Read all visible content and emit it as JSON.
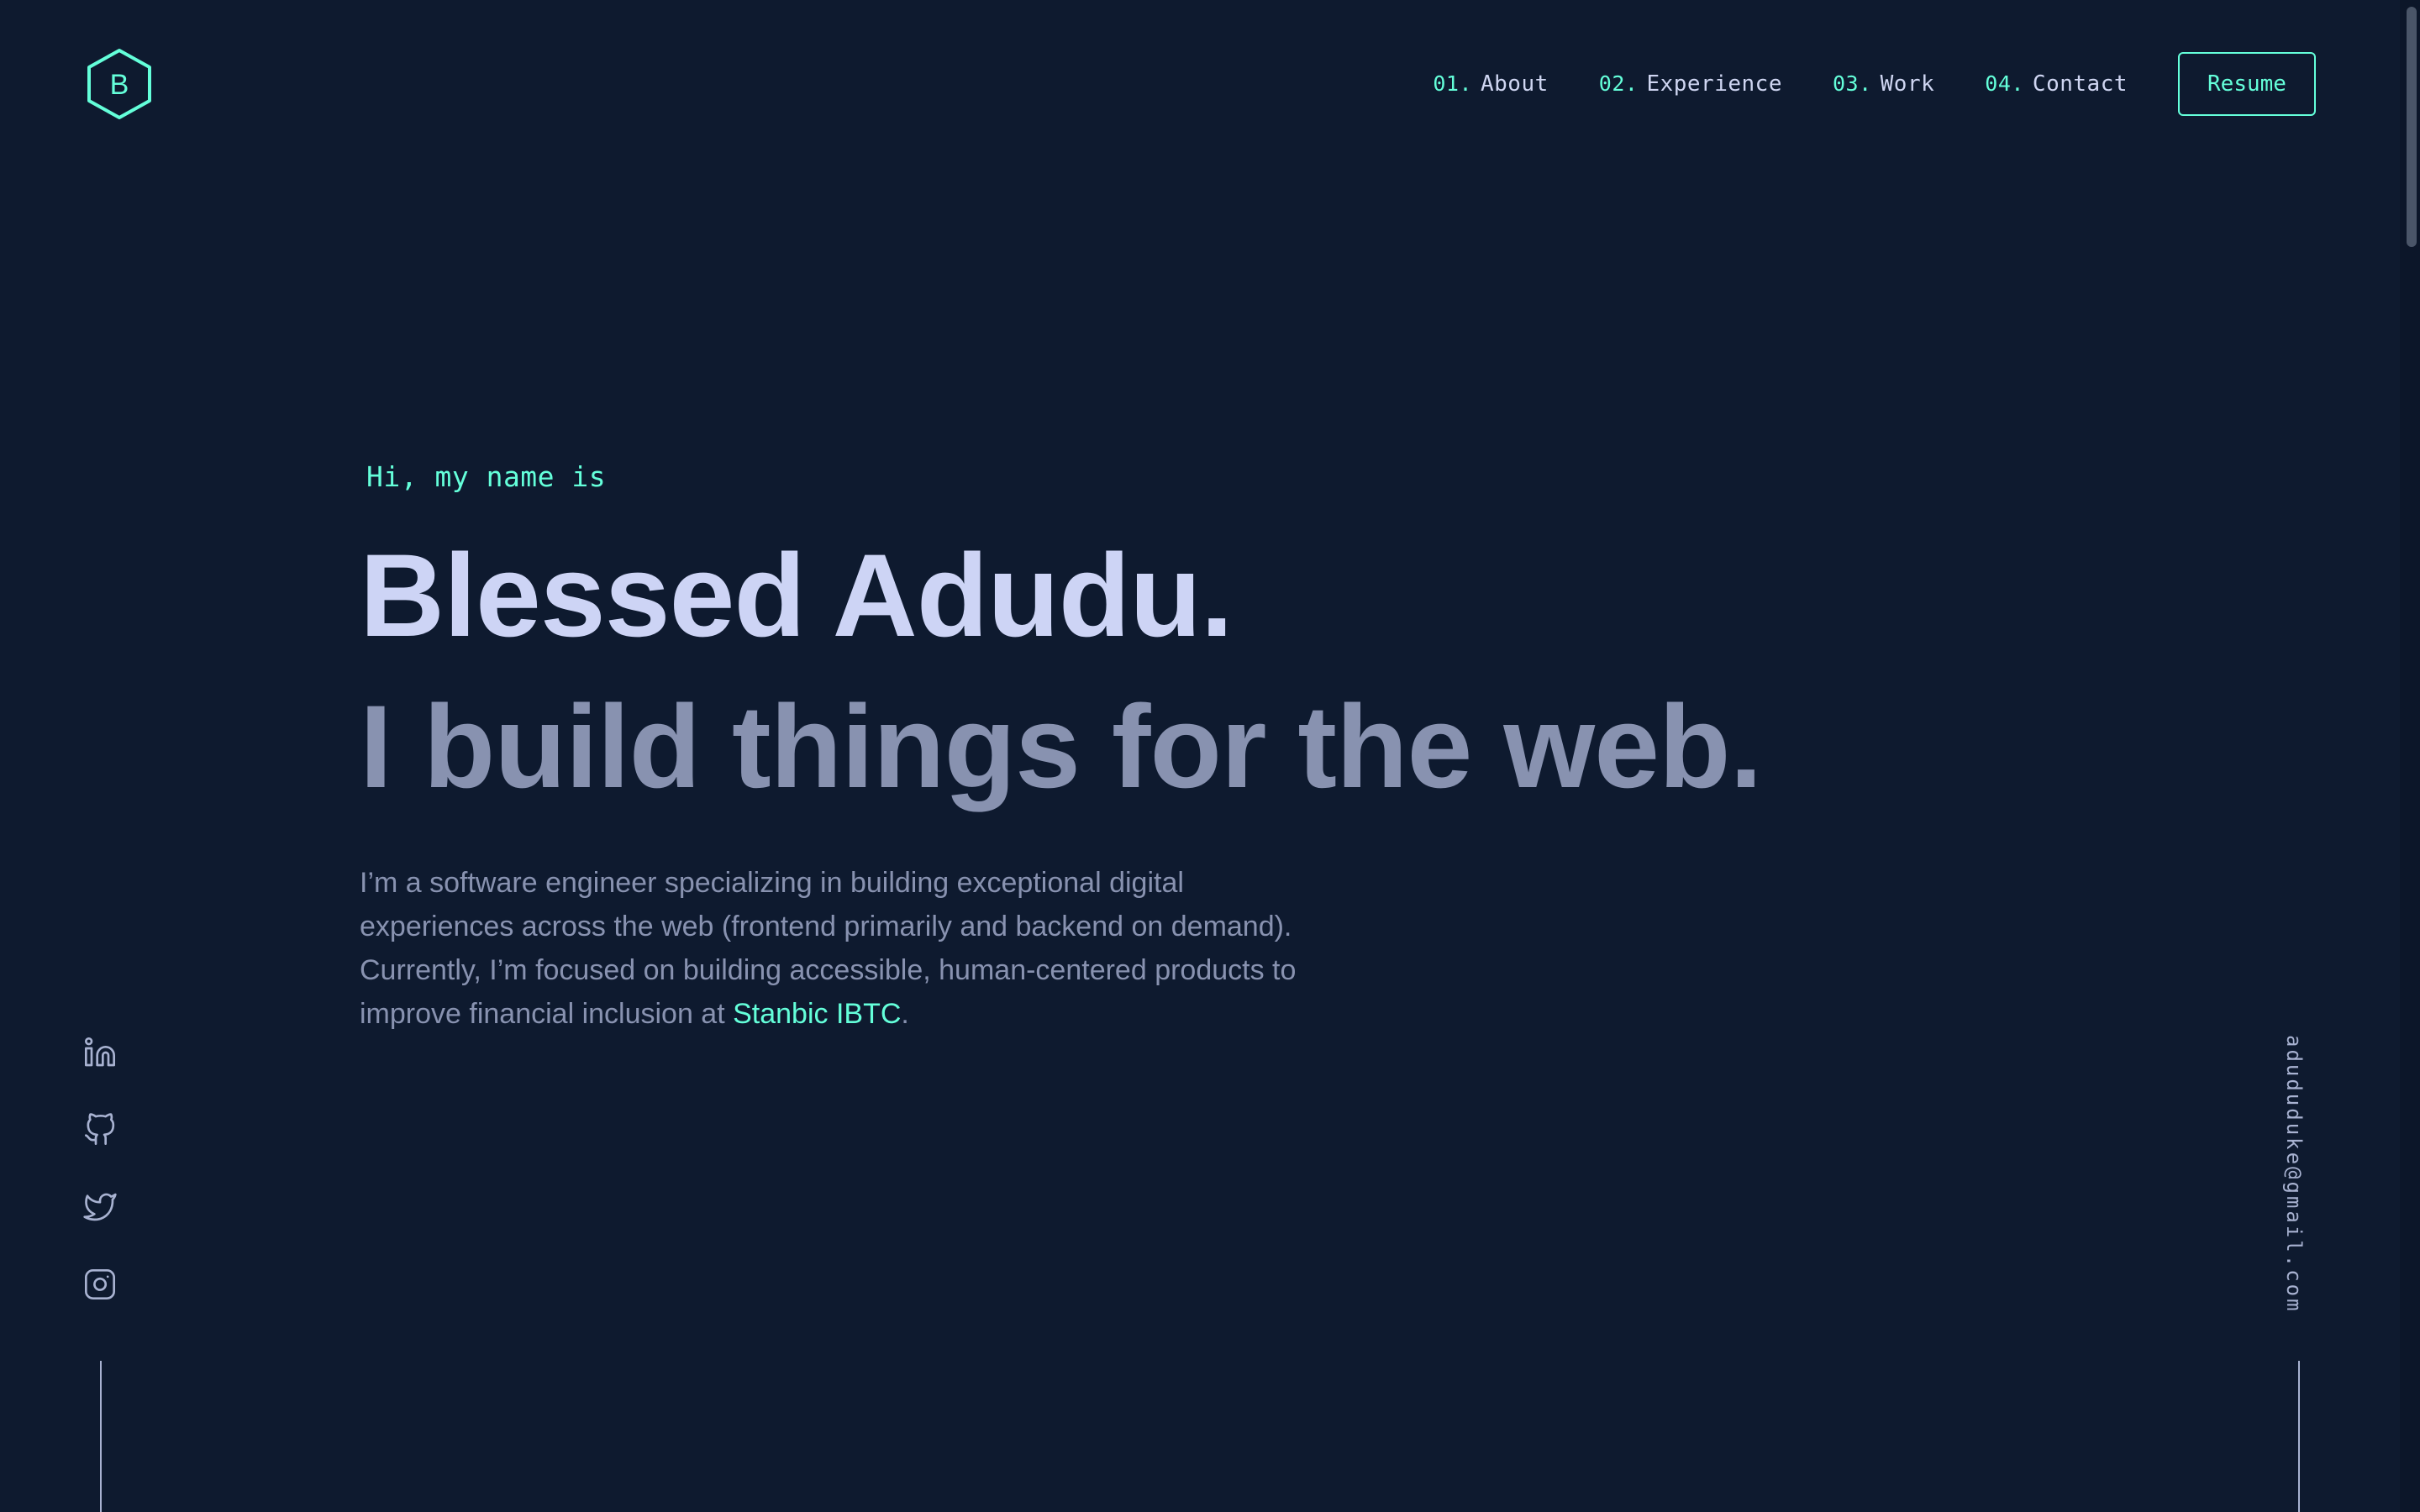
{
  "header": {
    "logo_letter": "B",
    "nav": [
      {
        "num": "01.",
        "label": "About"
      },
      {
        "num": "02.",
        "label": "Experience"
      },
      {
        "num": "03.",
        "label": "Work"
      },
      {
        "num": "04.",
        "label": "Contact"
      }
    ],
    "resume_label": "Resume"
  },
  "hero": {
    "intro": "Hi, my name is",
    "name": "Blessed Adudu.",
    "tagline": "I build things for the web.",
    "description": "I’m a software engineer specializing in building exceptional digital experiences across the web (frontend primarily and backend on demand). Currently, I’m focused on building accessible, human-centered products to improve financial inclusion at ",
    "company_link": "Stanbic IBTC",
    "description_end": "."
  },
  "social": {
    "items": [
      {
        "icon": "linkedin-icon"
      },
      {
        "icon": "github-icon"
      },
      {
        "icon": "twitter-icon"
      },
      {
        "icon": "instagram-icon"
      }
    ]
  },
  "email": {
    "address": "adududuke@gmail.com"
  },
  "colors": {
    "background": "#0e1a2f",
    "accent": "#64ffda",
    "heading": "#cdd4f5",
    "text": "#8892b0"
  }
}
